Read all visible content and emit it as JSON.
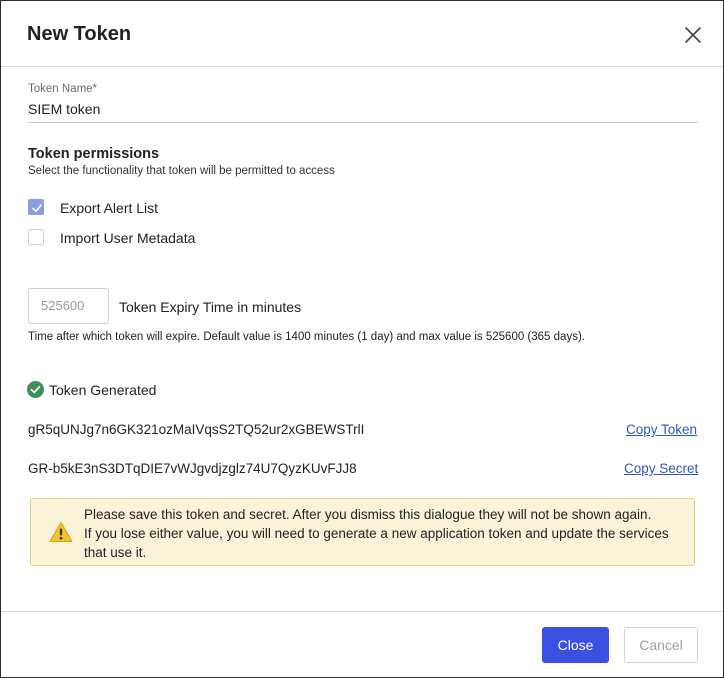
{
  "dialog": {
    "title": "New Token",
    "close_icon": "close-icon"
  },
  "token_name": {
    "label": "Token Name*",
    "value": "SIEM token"
  },
  "permissions": {
    "title": "Token permissions",
    "description": "Select the functionality that token will be permitted to access",
    "items": [
      {
        "label": "Export Alert List",
        "checked": true
      },
      {
        "label": "Import User Metadata",
        "checked": false
      }
    ]
  },
  "expiry": {
    "placeholder": "525600",
    "label": "Token Expiry Time in minutes",
    "help": "Time after which token will expire. Default value is 1400 minutes (1 day) and max value is 525600 (365 days)."
  },
  "generated": {
    "status": "Token Generated",
    "status_icon": "check-circle-icon",
    "token": "gR5qUNJg7n6GK321ozMaIVqsS2TQ52ur2xGBEWSTrlI",
    "copy_token_label": "Copy Token",
    "secret": "GR-b5kE3nS3DTqDIE7vWJgvdjzglz74U7QyzKUvFJJ8",
    "copy_secret_label": "Copy Secret"
  },
  "warning": {
    "icon": "warning-icon",
    "line1": "Please save this token and secret. After you dismiss this dialogue they will not be shown again.",
    "line2": "If you lose either value, you will need to generate a new application token and update the services",
    "line3": "that use it."
  },
  "footer": {
    "close_label": "Close",
    "cancel_label": "Cancel"
  },
  "colors": {
    "primary": "#3b4fe0",
    "link": "#2d55c9",
    "success": "#3f8f5a",
    "warning_bg": "#fbf3d8",
    "checkbox_checked": "#8e9be6"
  }
}
